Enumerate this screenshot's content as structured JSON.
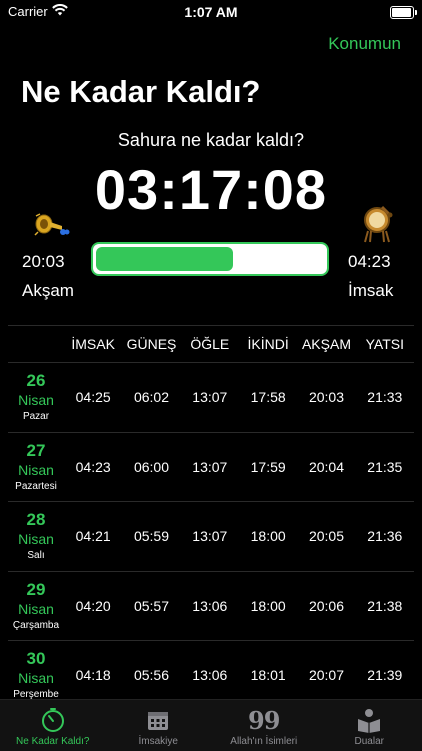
{
  "status": {
    "carrier": "Carrier",
    "time": "1:07 AM"
  },
  "header": {
    "location_button": "Konumun",
    "title": "Ne Kadar Kaldı?"
  },
  "countdown": {
    "subtitle": "Sahura ne kadar kaldı?",
    "value": "03:17:08",
    "progress": 0.6,
    "start": {
      "time": "20:03",
      "label": "Akşam",
      "icon": "trumpet-icon"
    },
    "end": {
      "time": "04:23",
      "label": "İmsak",
      "icon": "drum-icon"
    }
  },
  "colors": {
    "accent": "#34c759",
    "background": "#000000",
    "text": "#ffffff",
    "tab_inactive": "#8e8e93"
  },
  "table": {
    "headers": [
      "İMSAK",
      "GÜNEŞ",
      "ÖĞLE",
      "İKİNDİ",
      "AKŞAM",
      "YATSI"
    ],
    "rows": [
      {
        "day": "26",
        "month": "Nisan",
        "weekday": "Pazar",
        "times": [
          "04:25",
          "06:02",
          "13:07",
          "17:58",
          "20:03",
          "21:33"
        ]
      },
      {
        "day": "27",
        "month": "Nisan",
        "weekday": "Pazartesi",
        "times": [
          "04:23",
          "06:00",
          "13:07",
          "17:59",
          "20:04",
          "21:35"
        ]
      },
      {
        "day": "28",
        "month": "Nisan",
        "weekday": "Salı",
        "times": [
          "04:21",
          "05:59",
          "13:07",
          "18:00",
          "20:05",
          "21:36"
        ]
      },
      {
        "day": "29",
        "month": "Nisan",
        "weekday": "Çarşamba",
        "times": [
          "04:20",
          "05:57",
          "13:06",
          "18:00",
          "20:06",
          "21:38"
        ]
      },
      {
        "day": "30",
        "month": "Nisan",
        "weekday": "Perşembe",
        "times": [
          "04:18",
          "05:56",
          "13:06",
          "18:01",
          "20:07",
          "21:39"
        ]
      }
    ]
  },
  "tabs": [
    {
      "label": "Ne Kadar Kaldı?",
      "icon": "timer-icon",
      "active": true
    },
    {
      "label": "İmsakiye",
      "icon": "calendar-icon",
      "active": false
    },
    {
      "label": "Allah'ın İsimleri",
      "icon": "ninety-nine-icon",
      "icon_text": "99",
      "active": false
    },
    {
      "label": "Dualar",
      "icon": "praying-book-icon",
      "active": false
    }
  ]
}
